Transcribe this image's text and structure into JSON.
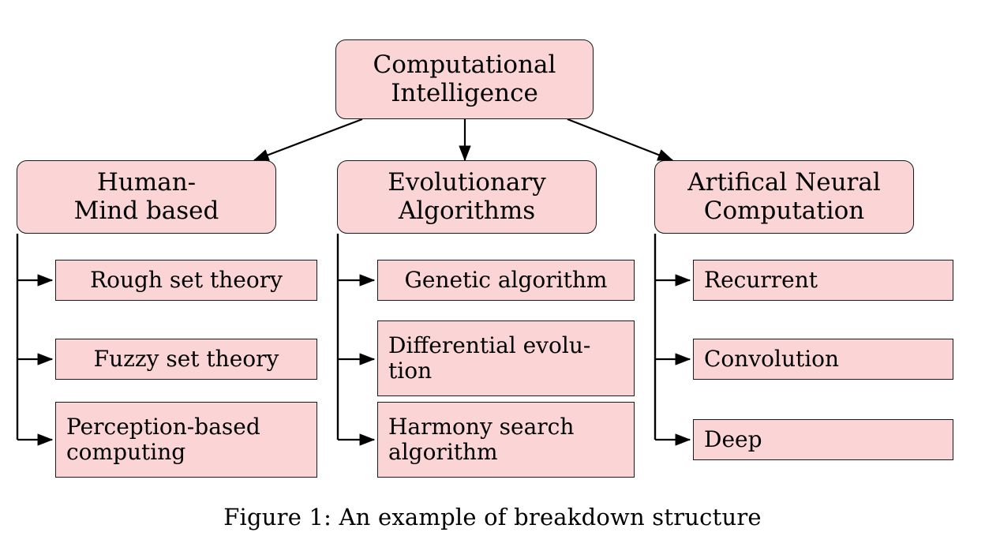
{
  "figure": {
    "caption": "Figure 1: An example of breakdown structure",
    "colors": {
      "node_fill": "#fbd5d5",
      "node_border": "#1a1a1a",
      "connector": "#000000",
      "background": "#ffffff"
    }
  },
  "root": {
    "id": "computational-intelligence",
    "lines": [
      "Computational",
      "Intelligence"
    ]
  },
  "branches": [
    {
      "id": "human-mind-based",
      "lines": [
        "Human-",
        "Mind based"
      ],
      "leaves": [
        {
          "id": "rough-set-theory",
          "lines": [
            "Rough set theory"
          ],
          "align": "center"
        },
        {
          "id": "fuzzy-set-theory",
          "lines": [
            "Fuzzy set theory"
          ],
          "align": "center"
        },
        {
          "id": "perception-based-computing",
          "lines": [
            "Perception-based",
            "computing"
          ],
          "align": "left"
        }
      ]
    },
    {
      "id": "evolutionary-algorithms",
      "lines": [
        "Evolutionary",
        "Algorithms"
      ],
      "leaves": [
        {
          "id": "genetic-algorithm",
          "lines": [
            "Genetic algorithm"
          ],
          "align": "center"
        },
        {
          "id": "differential-evolution",
          "lines": [
            "Differential evolu-",
            "tion"
          ],
          "align": "left"
        },
        {
          "id": "harmony-search-algorithm",
          "lines": [
            "Harmony search",
            "algorithm"
          ],
          "align": "left"
        }
      ]
    },
    {
      "id": "artifical-neural-computation",
      "lines": [
        "Artifical Neural",
        "Computation"
      ],
      "leaves": [
        {
          "id": "recurrent",
          "lines": [
            "Recurrent"
          ],
          "align": "left"
        },
        {
          "id": "convolution",
          "lines": [
            "Convolution"
          ],
          "align": "left"
        },
        {
          "id": "deep",
          "lines": [
            "Deep"
          ],
          "align": "left"
        }
      ]
    }
  ]
}
